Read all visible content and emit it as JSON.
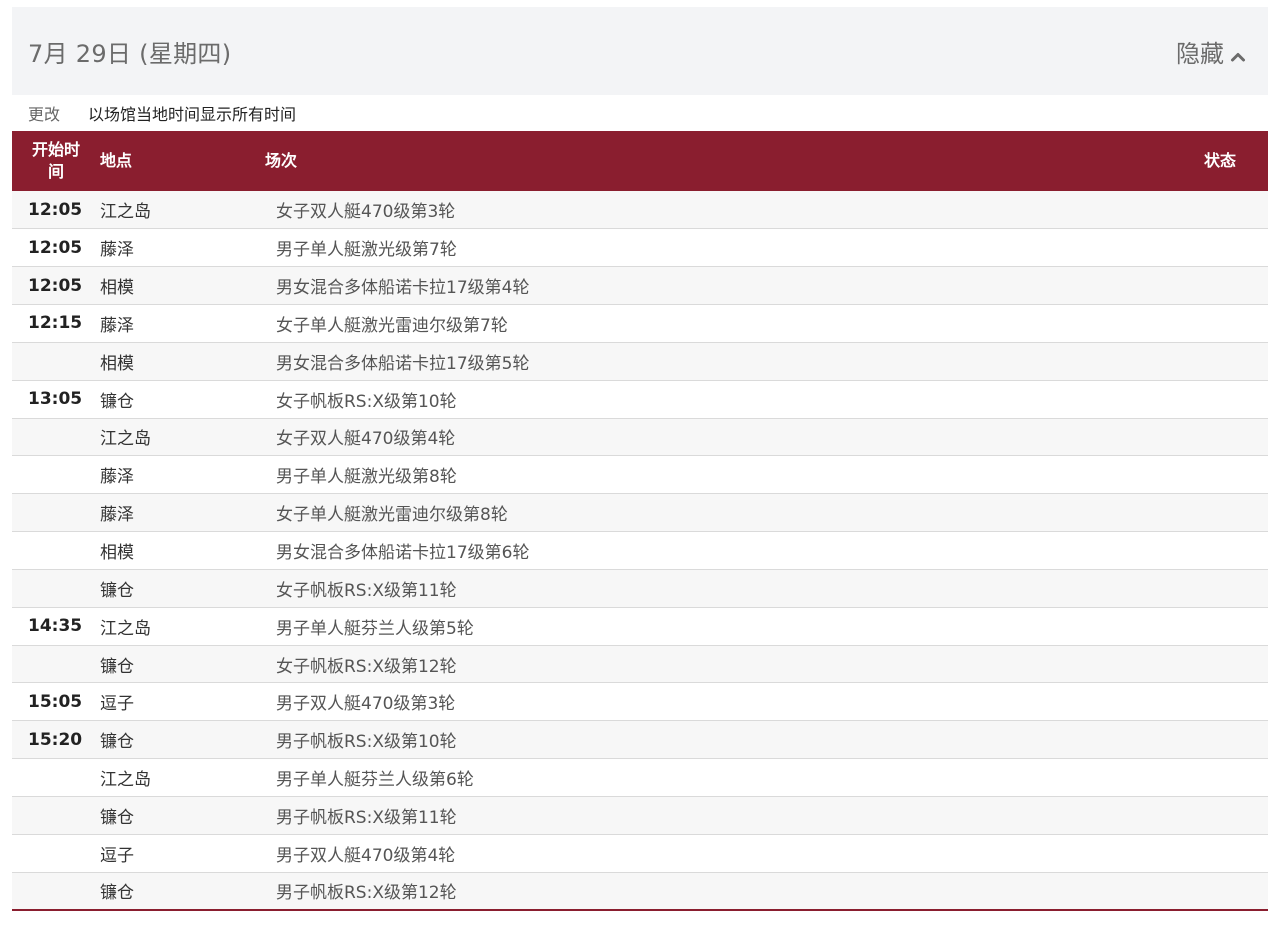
{
  "header": {
    "date_title": "7月 29日 (星期四)",
    "toggle_label": "隐藏"
  },
  "timezone": {
    "change_label": "更改",
    "description": "以场馆当地时间显示所有时间"
  },
  "table": {
    "columns": {
      "time": "开始时间",
      "venue": "地点",
      "event": "场次",
      "status": "状态"
    },
    "rows": [
      {
        "time": "12:05",
        "venue": "江之岛",
        "event": "女子双人艇470级第3轮",
        "status": ""
      },
      {
        "time": "12:05",
        "venue": "藤泽",
        "event": "男子单人艇激光级第7轮",
        "status": ""
      },
      {
        "time": "12:05",
        "venue": "相模",
        "event": "男女混合多体船诺卡拉17级第4轮",
        "status": ""
      },
      {
        "time": "12:15",
        "venue": "藤泽",
        "event": "女子单人艇激光雷迪尔级第7轮",
        "status": ""
      },
      {
        "time": "",
        "venue": "相模",
        "event": "男女混合多体船诺卡拉17级第5轮",
        "status": ""
      },
      {
        "time": "13:05",
        "venue": "镰仓",
        "event": "女子帆板RS:X级第10轮",
        "status": ""
      },
      {
        "time": "",
        "venue": "江之岛",
        "event": "女子双人艇470级第4轮",
        "status": ""
      },
      {
        "time": "",
        "venue": "藤泽",
        "event": "男子单人艇激光级第8轮",
        "status": ""
      },
      {
        "time": "",
        "venue": "藤泽",
        "event": "女子单人艇激光雷迪尔级第8轮",
        "status": ""
      },
      {
        "time": "",
        "venue": "相模",
        "event": "男女混合多体船诺卡拉17级第6轮",
        "status": ""
      },
      {
        "time": "",
        "venue": "镰仓",
        "event": "女子帆板RS:X级第11轮",
        "status": ""
      },
      {
        "time": "14:35",
        "venue": "江之岛",
        "event": "男子单人艇芬兰人级第5轮",
        "status": ""
      },
      {
        "time": "",
        "venue": "镰仓",
        "event": "女子帆板RS:X级第12轮",
        "status": ""
      },
      {
        "time": "15:05",
        "venue": "逗子",
        "event": "男子双人艇470级第3轮",
        "status": ""
      },
      {
        "time": "15:20",
        "venue": "镰仓",
        "event": "男子帆板RS:X级第10轮",
        "status": ""
      },
      {
        "time": "",
        "venue": "江之岛",
        "event": "男子单人艇芬兰人级第6轮",
        "status": ""
      },
      {
        "time": "",
        "venue": "镰仓",
        "event": "男子帆板RS:X级第11轮",
        "status": ""
      },
      {
        "time": "",
        "venue": "逗子",
        "event": "男子双人艇470级第4轮",
        "status": ""
      },
      {
        "time": "",
        "venue": "镰仓",
        "event": "男子帆板RS:X级第12轮",
        "status": ""
      }
    ]
  },
  "colors": {
    "header_bar": "#8a1e2f",
    "day_header_bg": "#f3f4f6"
  },
  "icons": {
    "toggle": "chevron-up-icon"
  }
}
